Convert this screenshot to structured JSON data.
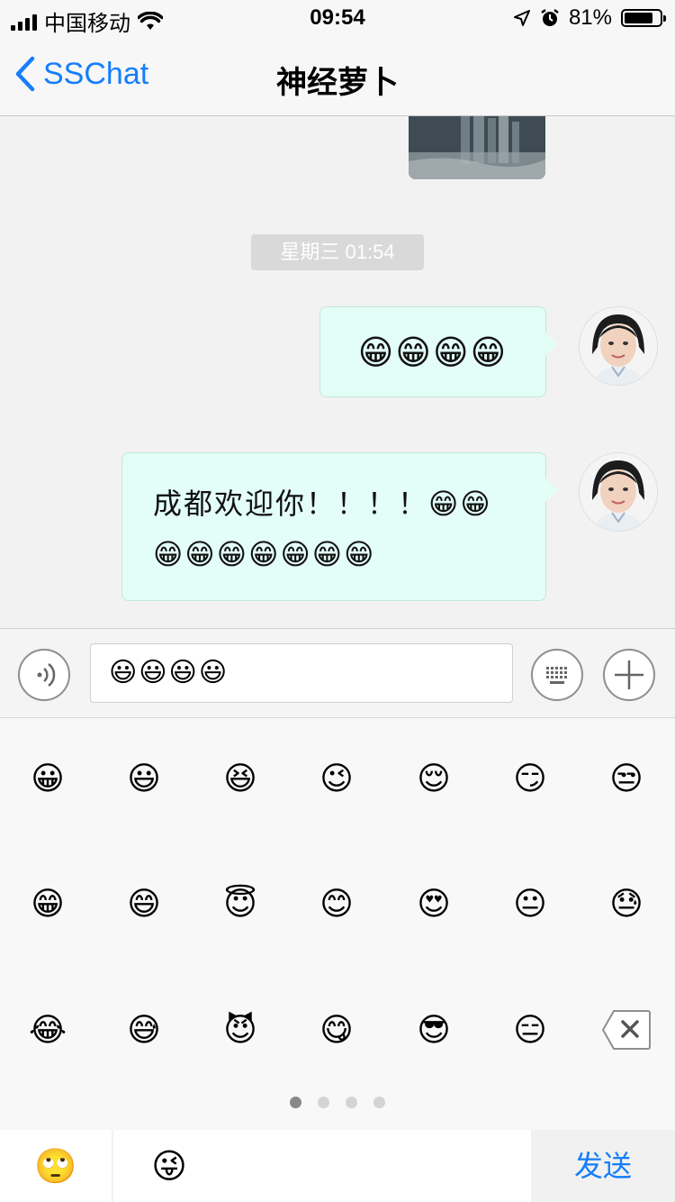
{
  "status_bar": {
    "carrier": "中国移动",
    "time": "09:54",
    "battery_percent": "81%",
    "battery_level": 0.81
  },
  "navbar": {
    "back_label": "SSChat",
    "title": "神经萝卜"
  },
  "messages": [
    {
      "type": "image"
    },
    {
      "type": "timestamp",
      "text": "星期三 01:54"
    },
    {
      "type": "text",
      "sender": "me",
      "text": "😁😁😁😁"
    },
    {
      "type": "text",
      "sender": "me",
      "text": "成都欢迎你！！！！😁😁😁😁😁😁😁😁😁"
    }
  ],
  "input": {
    "value": "😃😃😃😃"
  },
  "emoji_grid": [
    [
      "😀",
      "😃",
      "😆",
      "😉",
      "😌",
      "😏",
      "😒"
    ],
    [
      "😁",
      "😄",
      "😇",
      "😊",
      "😍",
      "😐",
      "😓"
    ],
    [
      "😂",
      "😅",
      "😈",
      "😋",
      "😎",
      "😑"
    ]
  ],
  "page_indicator": {
    "count": 4,
    "current": 1
  },
  "bottom_tabs": [
    "🙄",
    "😜"
  ],
  "send_label": "发送",
  "colors": {
    "accent": "#157efb",
    "bubble_bg": "#e3fdf7"
  }
}
